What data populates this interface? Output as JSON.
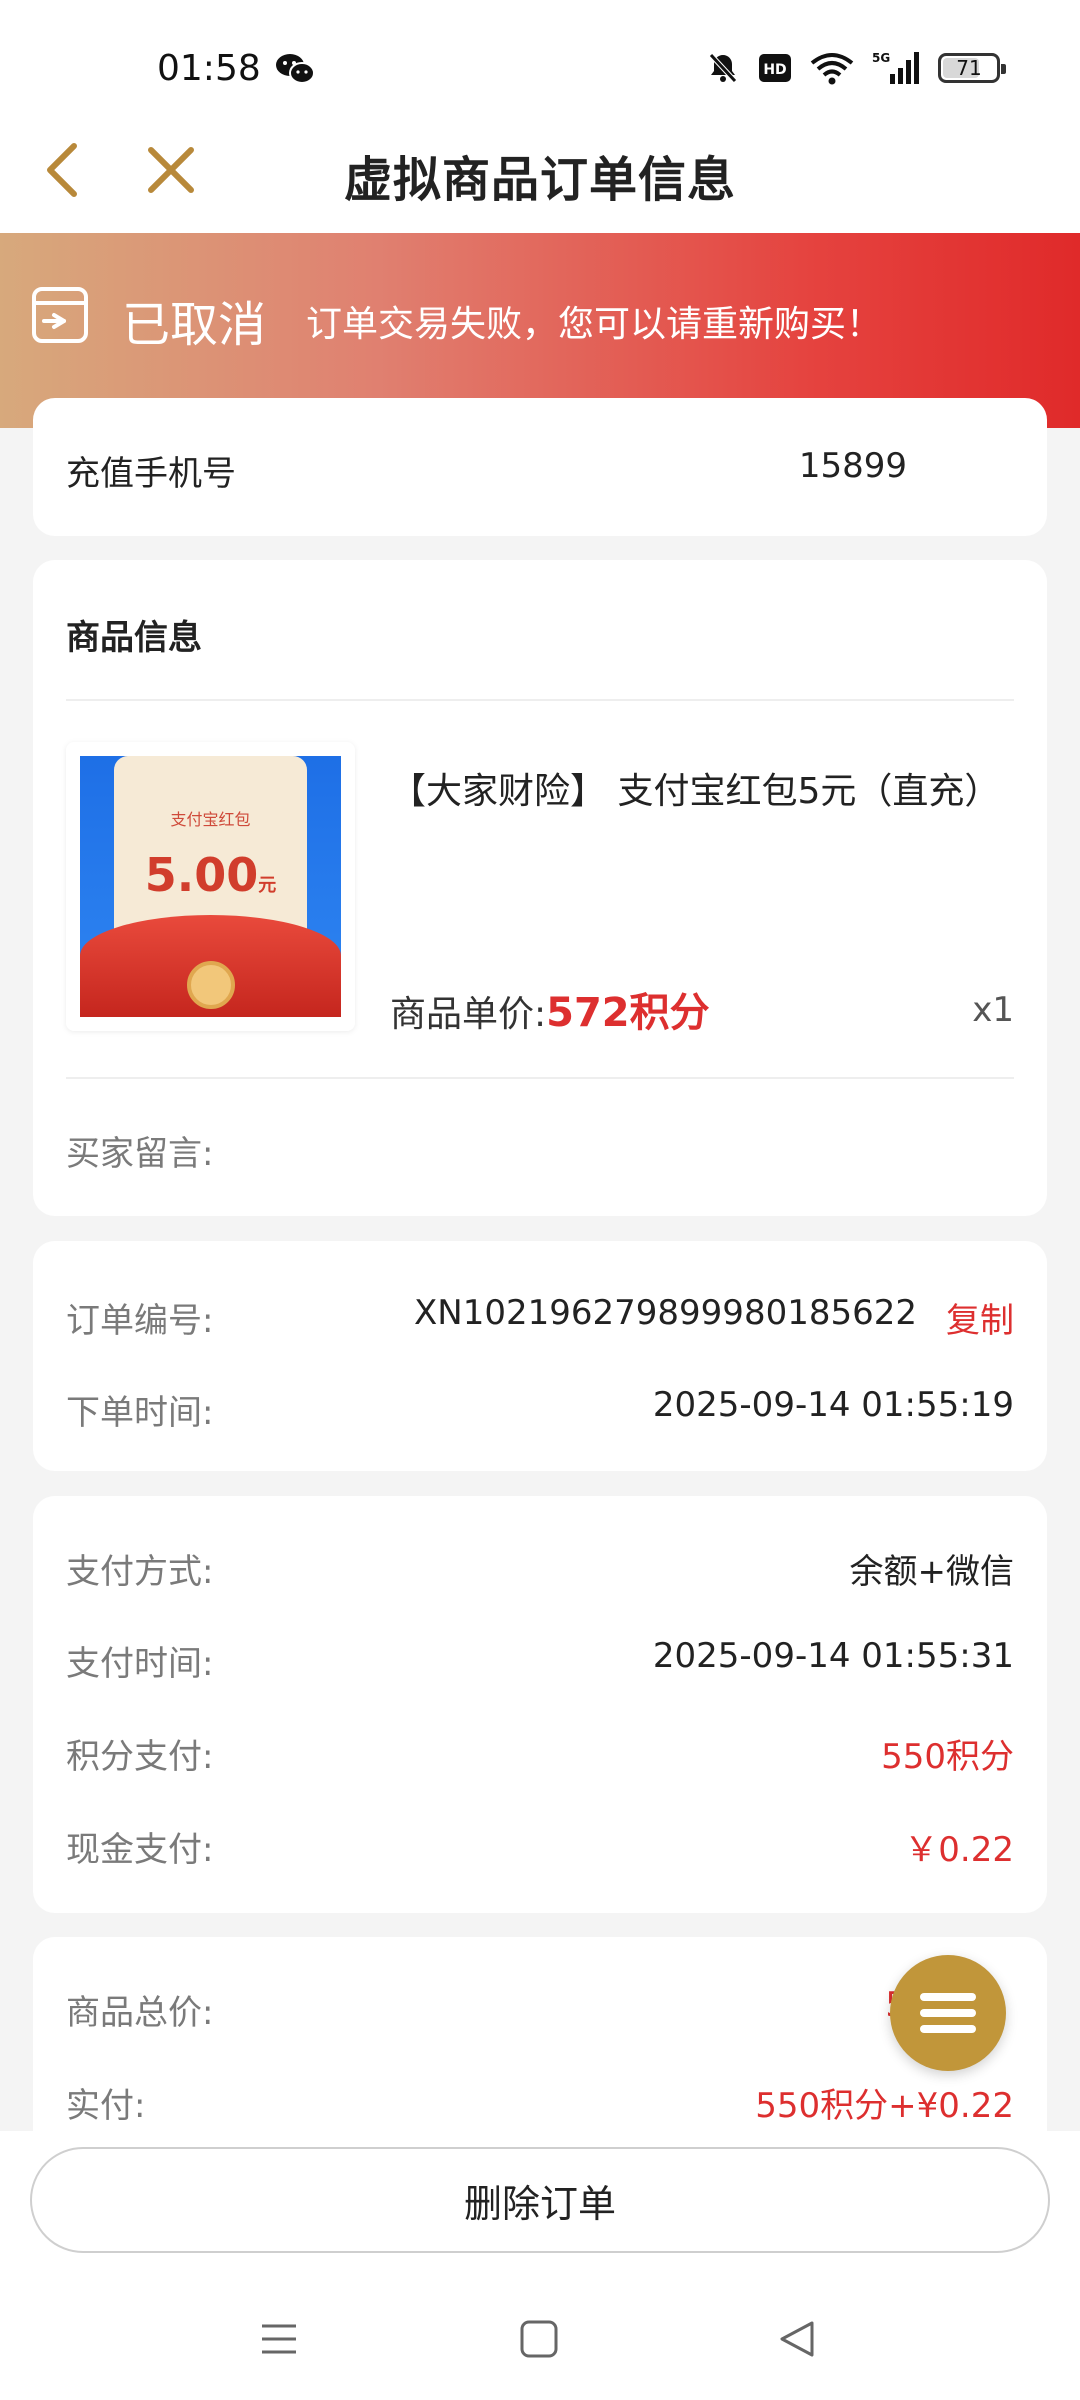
{
  "status_bar": {
    "time": "01:58",
    "battery": "71",
    "network": "5G"
  },
  "header": {
    "title": "虚拟商品订单信息"
  },
  "banner": {
    "status": "已取消",
    "message": "订单交易失败，您可以请重新购买！"
  },
  "recharge": {
    "label": "充值手机号",
    "value": "15899"
  },
  "product_card": {
    "section_title": "商品信息",
    "thumb_title": "支付宝红包",
    "thumb_amount": "5.00",
    "thumb_unit": "元",
    "name": "【大家财险】 支付宝红包5元（直充）",
    "price_label": "商品单价:",
    "price_value": "572积分",
    "quantity": "x1",
    "buyer_note_label": "买家留言:"
  },
  "order_info": {
    "number_label": "订单编号:",
    "number_value": "XN10219627989998018562​2",
    "copy_label": "复制",
    "time_label": "下单时间:",
    "time_value": "2025-09-14 01:55:19"
  },
  "payment": {
    "method_label": "支付方式:",
    "method_value": "余额+微信",
    "time_label": "支付时间:",
    "time_value": "2025-09-14 01:55:31",
    "points_label": "积分支付:",
    "points_value": "550积分",
    "cash_label": "现金支付:",
    "cash_value": "￥0.22"
  },
  "totals": {
    "total_label": "商品总价:",
    "total_value": "5",
    "paid_label": "实付:",
    "paid_value": "550积分+¥0.22"
  },
  "actions": {
    "delete_label": "删除订单"
  },
  "colors": {
    "accent_gold": "#c1963a",
    "price_red": "#dd2f2f",
    "banner_start": "#d7a97c",
    "banner_end": "#e02a2a"
  }
}
